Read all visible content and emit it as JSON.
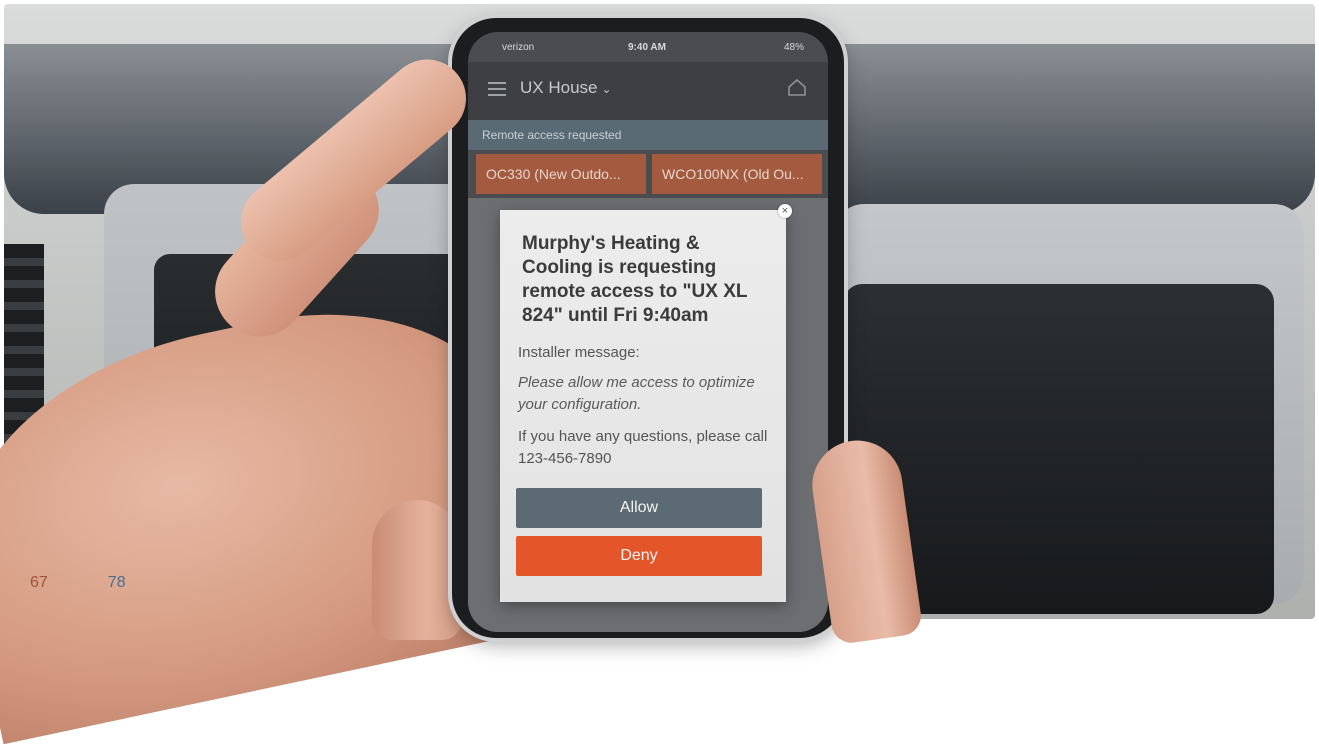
{
  "phone": {
    "status": {
      "carrier": "verizon",
      "time": "9:40 AM",
      "battery": "48%"
    },
    "header": {
      "house_name": "UX House"
    },
    "banner": "Remote access requested",
    "tiles": [
      "OC330 (New Outdo...",
      "WCO100NX (Old Ou..."
    ],
    "temps": [
      "67",
      "78"
    ]
  },
  "dialog": {
    "title": "Murphy's Heating & Cooling is requesting remote access to \"UX XL 824\" until Fri 9:40am",
    "installer_label": "Installer message:",
    "installer_message": "Please allow me access to optimize your configuration.",
    "questions": "If you have any questions, please call 123-456-7890",
    "allow_label": "Allow",
    "deny_label": "Deny"
  },
  "colors": {
    "allow": "#5c6a73",
    "deny": "#e4562a",
    "tile": "#a35a3e"
  }
}
